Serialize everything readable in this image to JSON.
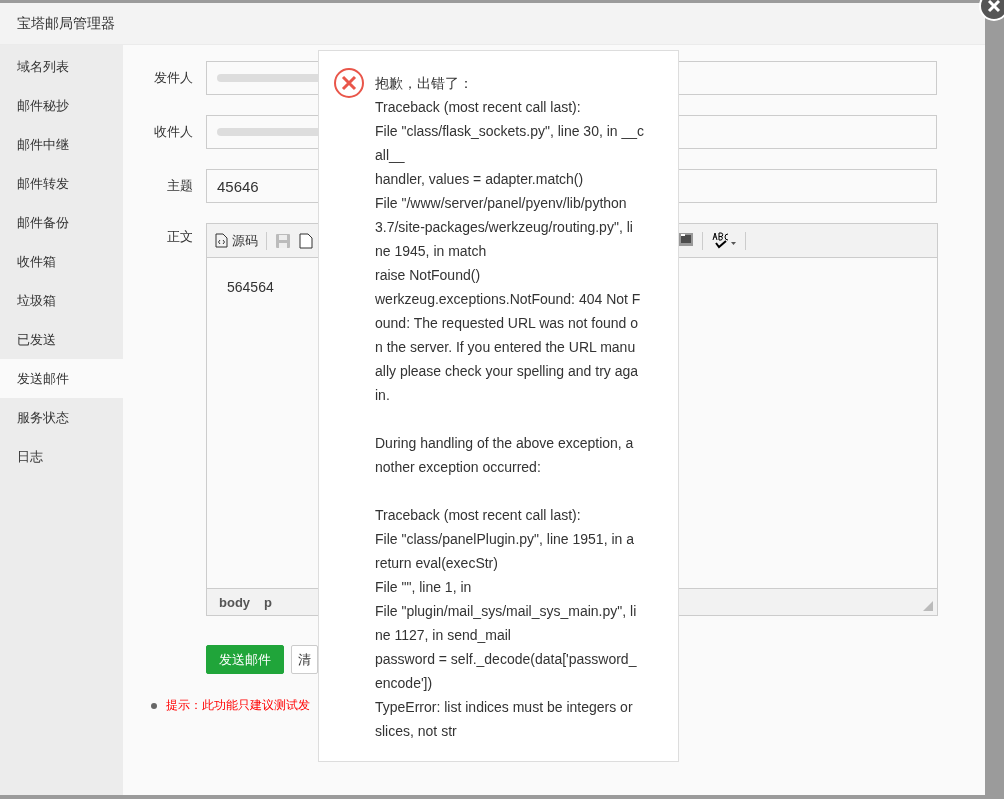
{
  "window": {
    "title": "宝塔邮局管理器"
  },
  "sidebar": {
    "items": [
      {
        "label": "域名列表",
        "selected": false
      },
      {
        "label": "邮件秘抄",
        "selected": false
      },
      {
        "label": "邮件中继",
        "selected": false
      },
      {
        "label": "邮件转发",
        "selected": false
      },
      {
        "label": "邮件备份",
        "selected": false
      },
      {
        "label": "收件箱",
        "selected": false
      },
      {
        "label": "垃圾箱",
        "selected": false
      },
      {
        "label": "已发送",
        "selected": false
      },
      {
        "label": "发送邮件",
        "selected": true
      },
      {
        "label": "服务状态",
        "selected": false
      },
      {
        "label": "日志",
        "selected": false
      }
    ]
  },
  "form": {
    "fields": [
      {
        "label": "发件人",
        "kind": "redacted"
      },
      {
        "label": "收件人",
        "kind": "redacted"
      },
      {
        "label": "主题",
        "kind": "text",
        "value": "45646"
      }
    ],
    "body_label": "正文",
    "editor": {
      "source_button": "源码",
      "content": "564564",
      "path": [
        "body",
        "p"
      ]
    },
    "buttons": [
      {
        "label": "发送邮件",
        "kind": "primary"
      },
      {
        "label": "清",
        "kind": "default"
      }
    ],
    "hint": "提示：此功能只建议测试发"
  },
  "error_popup": {
    "paragraphs": [
      [
        "抱歉，出错了：",
        "Traceback (most recent call last):",
        "File \"class/flask_sockets.py\", line 30, in __c",
        "all__",
        "handler, values = adapter.match()",
        "File \"/www/server/panel/pyenv/lib/python",
        "3.7/site-packages/werkzeug/routing.py\", li",
        "ne 1945, in match",
        "raise NotFound()",
        "werkzeug.exceptions.NotFound: 404 Not F",
        "ound: The requested URL was not found o",
        "n the server. If you entered the URL manu",
        "ally please check your spelling and try aga",
        "in."
      ],
      [
        "During handling of the above exception, a",
        "nother exception occurred:"
      ],
      [
        "Traceback (most recent call last):",
        "File \"class/panelPlugin.py\", line 1951, in a",
        "return eval(execStr)",
        "File \"\", line 1, in",
        "File \"plugin/mail_sys/mail_sys_main.py\", li",
        "ne 1127, in send_mail",
        "password = self._decode(data['password_",
        "encode'])",
        "TypeError: list indices must be integers or",
        "slices, not str"
      ]
    ]
  }
}
